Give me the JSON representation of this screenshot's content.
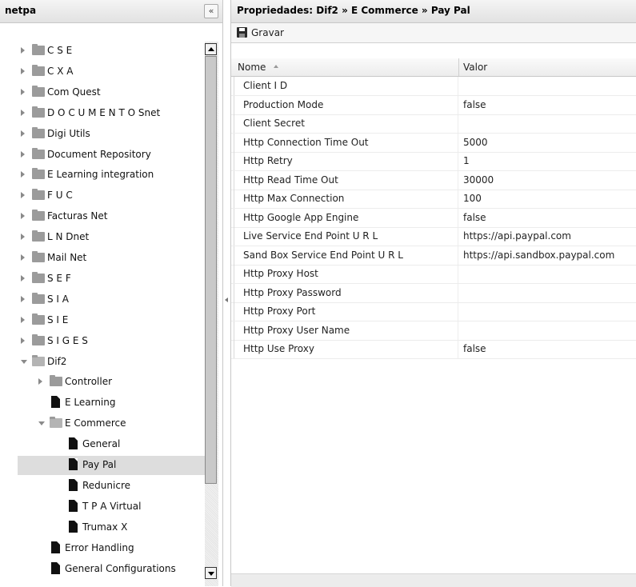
{
  "left_panel": {
    "title": "netpa",
    "collapse_symbol": "«",
    "tree": [
      {
        "label": "C S E",
        "type": "folder",
        "depth": 0,
        "expanded": false
      },
      {
        "label": "C X A",
        "type": "folder",
        "depth": 0,
        "expanded": false
      },
      {
        "label": "Com Quest",
        "type": "folder",
        "depth": 0,
        "expanded": false
      },
      {
        "label": "D O C U M E N T O Snet",
        "type": "folder",
        "depth": 0,
        "expanded": false
      },
      {
        "label": "Digi Utils",
        "type": "folder",
        "depth": 0,
        "expanded": false
      },
      {
        "label": "Document Repository",
        "type": "folder",
        "depth": 0,
        "expanded": false
      },
      {
        "label": "E Learning integration",
        "type": "folder",
        "depth": 0,
        "expanded": false
      },
      {
        "label": "F U C",
        "type": "folder",
        "depth": 0,
        "expanded": false
      },
      {
        "label": "Facturas Net",
        "type": "folder",
        "depth": 0,
        "expanded": false
      },
      {
        "label": "L N Dnet",
        "type": "folder",
        "depth": 0,
        "expanded": false
      },
      {
        "label": "Mail Net",
        "type": "folder",
        "depth": 0,
        "expanded": false
      },
      {
        "label": "S E F",
        "type": "folder",
        "depth": 0,
        "expanded": false
      },
      {
        "label": "S I A",
        "type": "folder",
        "depth": 0,
        "expanded": false
      },
      {
        "label": "S I E",
        "type": "folder",
        "depth": 0,
        "expanded": false
      },
      {
        "label": "S I G E S",
        "type": "folder",
        "depth": 0,
        "expanded": false
      },
      {
        "label": "Dif2",
        "type": "folder",
        "depth": 0,
        "expanded": true
      },
      {
        "label": "Controller",
        "type": "folder",
        "depth": 1,
        "expanded": false
      },
      {
        "label": "E Learning",
        "type": "doc",
        "depth": 1
      },
      {
        "label": "E Commerce",
        "type": "folder",
        "depth": 1,
        "expanded": true
      },
      {
        "label": "General",
        "type": "doc",
        "depth": 2
      },
      {
        "label": "Pay Pal",
        "type": "doc",
        "depth": 2,
        "selected": true
      },
      {
        "label": "Redunicre",
        "type": "doc",
        "depth": 2
      },
      {
        "label": "T P A Virtual",
        "type": "doc",
        "depth": 2
      },
      {
        "label": "Trumax X",
        "type": "doc",
        "depth": 2
      },
      {
        "label": "Error Handling",
        "type": "doc",
        "depth": 1
      },
      {
        "label": "General Configurations",
        "type": "doc",
        "depth": 1
      }
    ]
  },
  "right_panel": {
    "title": "Propriedades: Dif2 » E Commerce » Pay Pal",
    "toolbar": {
      "save_label": "Gravar",
      "save_icon": "save-icon"
    },
    "grid": {
      "columns": [
        "Nome",
        "Valor"
      ],
      "sort_column": "Nome",
      "sort_direction": "ascending",
      "rows": [
        {
          "name": "Client I D",
          "value": ""
        },
        {
          "name": "Production Mode",
          "value": "false"
        },
        {
          "name": "Client Secret",
          "value": ""
        },
        {
          "name": "Http Connection Time Out",
          "value": "5000"
        },
        {
          "name": "Http Retry",
          "value": "1"
        },
        {
          "name": "Http Read Time Out",
          "value": "30000"
        },
        {
          "name": "Http Max Connection",
          "value": "100"
        },
        {
          "name": "Http Google App Engine",
          "value": "false"
        },
        {
          "name": "Live Service End Point U R L",
          "value": "https://api.paypal.com"
        },
        {
          "name": "Sand Box Service End Point U R L",
          "value": "https://api.sandbox.paypal.com"
        },
        {
          "name": "Http Proxy Host",
          "value": ""
        },
        {
          "name": "Http Proxy Password",
          "value": ""
        },
        {
          "name": "Http Proxy Port",
          "value": ""
        },
        {
          "name": "Http Proxy User Name",
          "value": ""
        },
        {
          "name": "Http Use Proxy",
          "value": "false"
        }
      ]
    }
  },
  "colors": {
    "selected_row": "#dddddd",
    "header_bg": "#e8e8e8",
    "folder": "#9b9b9b"
  }
}
